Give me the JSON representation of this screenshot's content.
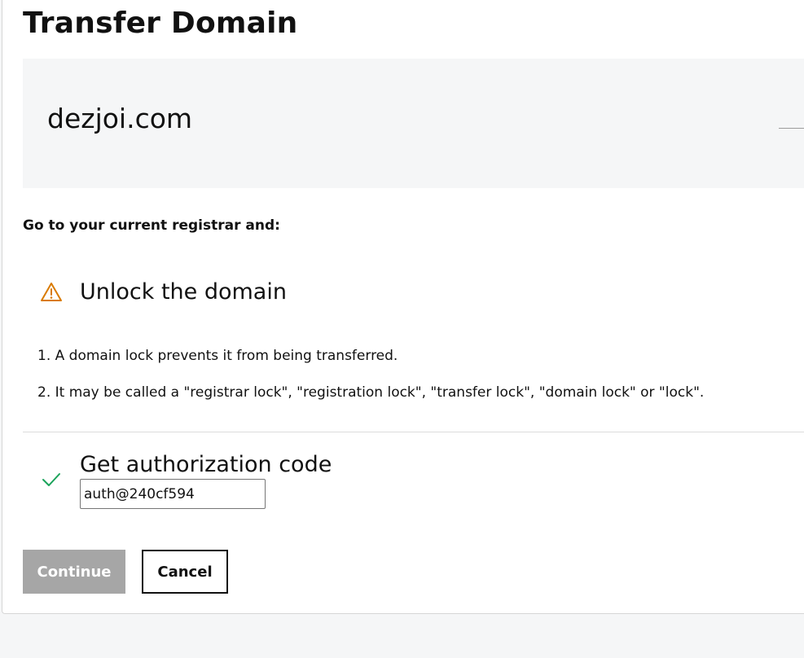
{
  "page": {
    "title": "Transfer Domain"
  },
  "domain": {
    "name": "dezjoi.com"
  },
  "instructions": "Go to your current registrar and:",
  "steps": {
    "unlock": {
      "title": "Unlock the domain",
      "icon": "warning-triangle-icon",
      "icon_color": "#d97a00",
      "items": [
        "1. A domain lock prevents it from being transferred.",
        "2. It may be called a \"registrar lock\", \"registration lock\", \"transfer lock\", \"domain lock\" or \"lock\"."
      ]
    },
    "auth": {
      "title": "Get authorization code",
      "icon": "checkmark-icon",
      "icon_color": "#1aa35a",
      "code_value": "auth@240cf594"
    }
  },
  "actions": {
    "continue_label": "Continue",
    "cancel_label": "Cancel",
    "continue_disabled_color": "#a6a6a6"
  }
}
